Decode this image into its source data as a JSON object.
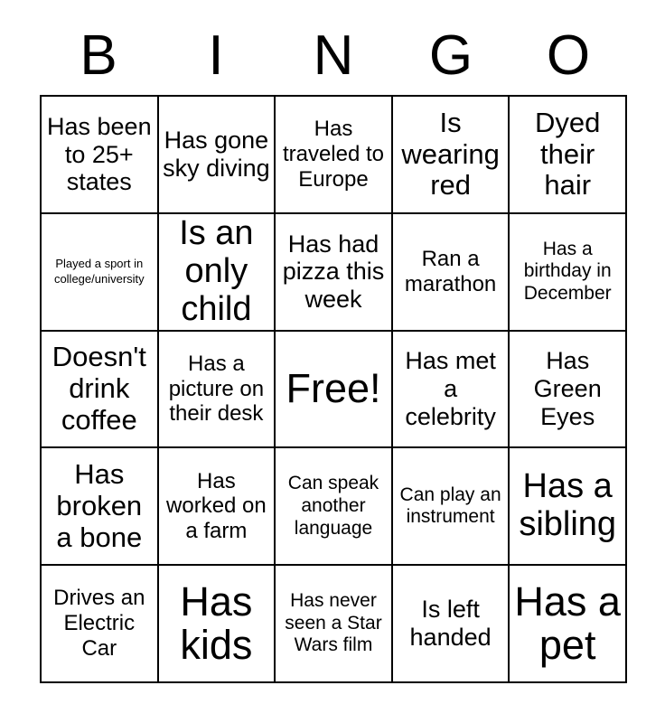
{
  "card": {
    "title": "BINGO",
    "header_letters": [
      "B",
      "I",
      "N",
      "G",
      "O"
    ],
    "rows": 5,
    "columns": 5,
    "free_space": {
      "row": 3,
      "column": 3,
      "label": "Free!"
    },
    "colors": {
      "background": "#ffffff",
      "text": "#000000",
      "border": "#000000"
    },
    "squares": [
      [
        {
          "text": "Has been to 25+ states",
          "size": "lg"
        },
        {
          "text": "Has gone sky diving",
          "size": "lg"
        },
        {
          "text": "Has traveled to Europe",
          "size": "md"
        },
        {
          "text": "Is wearing red",
          "size": "xl"
        },
        {
          "text": "Dyed their hair",
          "size": "xl"
        }
      ],
      [
        {
          "text": "Played a sport in college/university",
          "size": "xs"
        },
        {
          "text": "Is an only child",
          "size": "2xl"
        },
        {
          "text": "Has had pizza this week",
          "size": "lg"
        },
        {
          "text": "Ran a marathon",
          "size": "md"
        },
        {
          "text": "Has a birthday in December",
          "size": "sm"
        }
      ],
      [
        {
          "text": "Doesn't drink coffee",
          "size": "xl"
        },
        {
          "text": "Has a picture on their desk",
          "size": "md"
        },
        {
          "text": "Free!",
          "size": "3xl"
        },
        {
          "text": "Has met a celebrity",
          "size": "lg"
        },
        {
          "text": "Has Green Eyes",
          "size": "lg"
        }
      ],
      [
        {
          "text": "Has broken a bone",
          "size": "xl"
        },
        {
          "text": "Has worked on a farm",
          "size": "md"
        },
        {
          "text": "Can speak another language",
          "size": "sm"
        },
        {
          "text": "Can play an instrument",
          "size": "sm"
        },
        {
          "text": "Has a sibling",
          "size": "2xl"
        }
      ],
      [
        {
          "text": "Drives an Electric Car",
          "size": "md"
        },
        {
          "text": "Has kids",
          "size": "3xl"
        },
        {
          "text": "Has never seen a Star Wars film",
          "size": "sm"
        },
        {
          "text": "Is left handed",
          "size": "lg"
        },
        {
          "text": "Has a pet",
          "size": "3xl"
        }
      ]
    ]
  }
}
